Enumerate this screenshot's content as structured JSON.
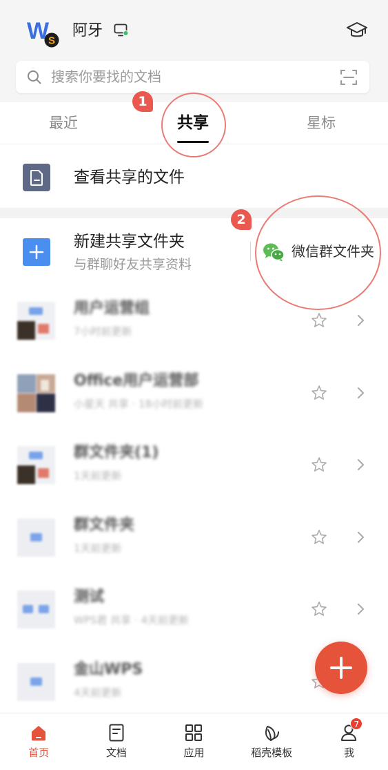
{
  "header": {
    "logo": {
      "letter": "W",
      "badge": "S",
      "icon": "wps-logo"
    },
    "username": "阿牙",
    "device_icon": "monitor-icon",
    "online_color": "#3cc06a",
    "right_icon": "graduation-cap-icon"
  },
  "search": {
    "placeholder": "搜索你要找的文档",
    "icon": "search-icon",
    "scan_icon": "scan-icon"
  },
  "tabs": [
    {
      "label": "最近",
      "active": false
    },
    {
      "label": "共享",
      "active": true
    },
    {
      "label": "星标",
      "active": false
    }
  ],
  "shared_files": {
    "label": "查看共享的文件",
    "icon": "document-icon"
  },
  "new_folder": {
    "title": "新建共享文件夹",
    "subtitle": "与群聊好友共享资料",
    "icon": "plus-icon",
    "wechat_label": "微信群文件夹",
    "wechat_icon": "wechat-icon"
  },
  "folders": [
    {
      "title": "用户运营组",
      "meta": "7小时前更新",
      "starred": false
    },
    {
      "title": "Office用户运营部",
      "meta": "小星天 共享 · 18小时前更新",
      "starred": false
    },
    {
      "title": "群文件夹(1)",
      "meta": "1天前更新",
      "starred": false
    },
    {
      "title": "群文件夹",
      "meta": "1天前更新",
      "starred": false
    },
    {
      "title": "测试",
      "meta": "WPS君 共享 · 4天前更新",
      "starred": false
    },
    {
      "title": "金山WPS",
      "meta": "4天前更新",
      "starred": false
    }
  ],
  "fab": {
    "icon": "plus-icon"
  },
  "bottom_nav": [
    {
      "label": "首页",
      "icon": "home-icon",
      "active": true
    },
    {
      "label": "文档",
      "icon": "document-icon",
      "active": false
    },
    {
      "label": "应用",
      "icon": "grid-icon",
      "active": false
    },
    {
      "label": "稻壳模板",
      "icon": "leaf-icon",
      "active": false
    },
    {
      "label": "我",
      "icon": "user-icon",
      "active": false,
      "badge": "7"
    }
  ],
  "annotations": [
    {
      "number": "1"
    },
    {
      "number": "2"
    }
  ],
  "colors": {
    "accent": "#e5533b",
    "annotation": "#e9594f",
    "folder_blue": "#4a8ff0",
    "wechat_green": "#5ebc57",
    "text": "#222222",
    "muted": "#9a9a9a"
  }
}
